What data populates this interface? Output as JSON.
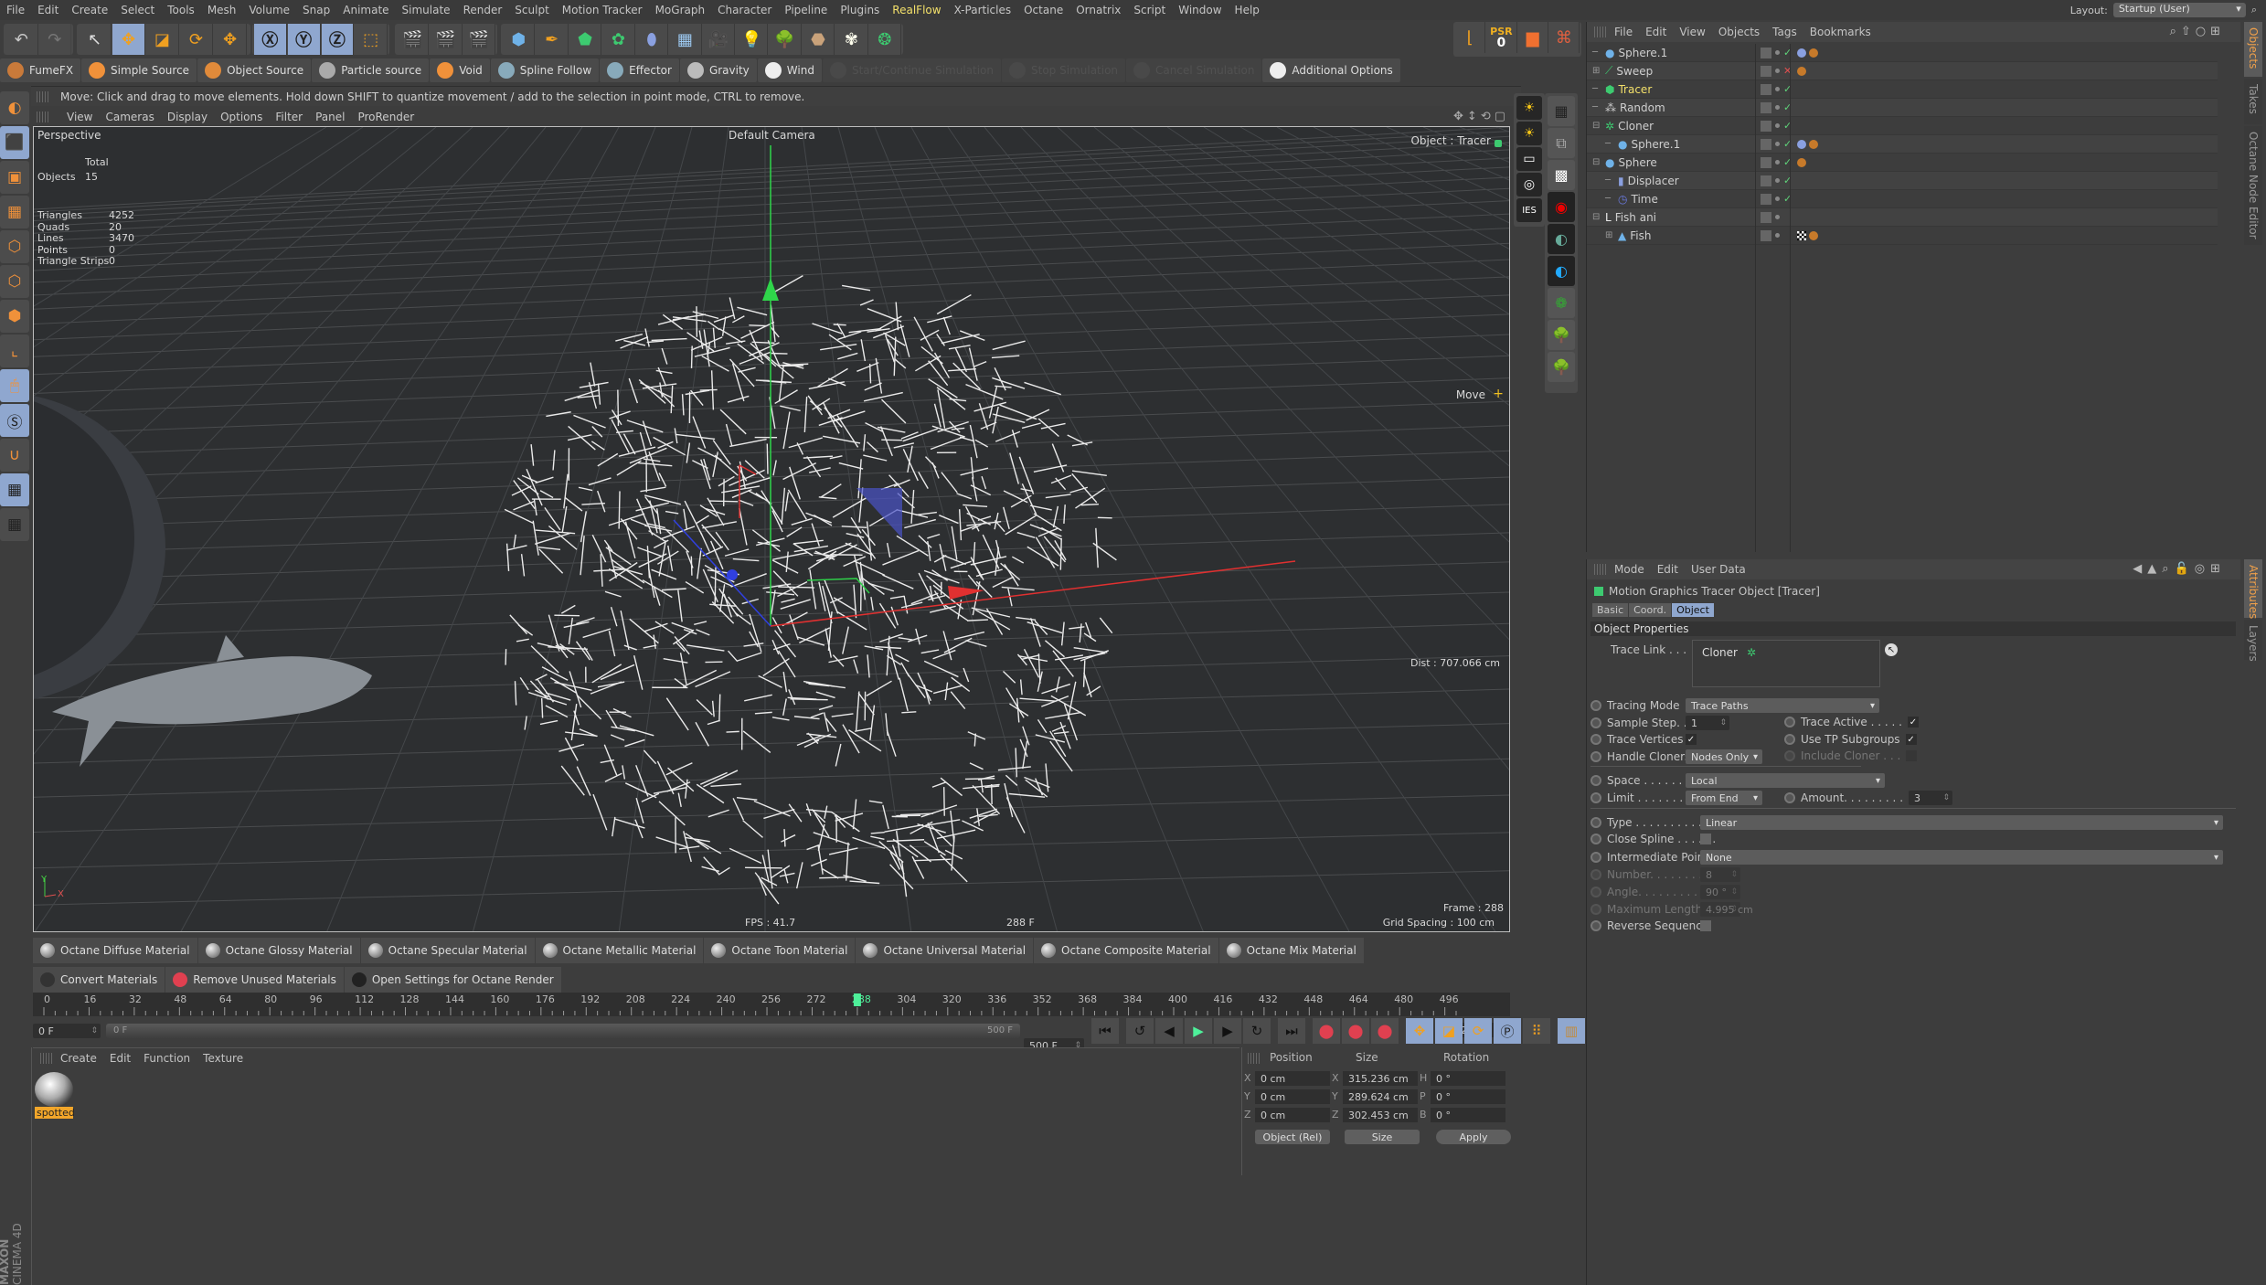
{
  "menubar": {
    "items": [
      "File",
      "Edit",
      "Create",
      "Select",
      "Tools",
      "Mesh",
      "Volume",
      "Snap",
      "Animate",
      "Simulate",
      "Render",
      "Sculpt",
      "Motion Tracker",
      "MoGraph",
      "Character",
      "Pipeline",
      "Plugins",
      "RealFlow",
      "X-Particles",
      "Octane",
      "Ornatrix",
      "Script",
      "Window",
      "Help"
    ],
    "highlighted": "RealFlow",
    "layout_label": "Layout:",
    "layout_value": "Startup (User)"
  },
  "main_toolbar": {
    "groups": [
      [
        "undo-icon",
        "redo-icon"
      ],
      [
        "live-selection-icon",
        "move-icon",
        "scale-icon",
        "rotate-icon"
      ],
      [
        "recent-tools-icon"
      ],
      [
        "x-axis-lock-icon",
        "y-axis-lock-icon",
        "z-axis-lock-icon",
        "coordinate-system-icon"
      ],
      [
        "render-view-icon",
        "render-to-picture-viewer-icon",
        "render-settings-icon"
      ],
      [
        "cube-icon",
        "pen-icon",
        "subdivision-icon",
        "array-icon",
        "deformer-icon",
        "floor-icon",
        "camera-icon",
        "light-icon",
        "tree-icon",
        "rock-icon",
        "flower-icon",
        "gear-plant-icon"
      ]
    ],
    "right_group": {
      "psr_label": "PSR",
      "psr_value": "0"
    }
  },
  "realflow_bar": {
    "buttons": [
      {
        "label": "FumeFX",
        "icon": "fumefx-icon",
        "enabled": true
      },
      {
        "label": "Simple Source",
        "icon": "simple-source-icon",
        "enabled": true
      },
      {
        "label": "Object Source",
        "icon": "object-source-icon",
        "enabled": true
      },
      {
        "label": "Particle source",
        "icon": "particle-source-icon",
        "enabled": true
      },
      {
        "label": "Void",
        "icon": "void-icon",
        "enabled": true
      },
      {
        "label": "Spline Follow",
        "icon": "spline-follow-icon",
        "enabled": true
      },
      {
        "label": "Effector",
        "icon": "effector-icon",
        "enabled": true
      },
      {
        "label": "Gravity",
        "icon": "gravity-icon",
        "enabled": true
      },
      {
        "label": "Wind",
        "icon": "wind-icon",
        "enabled": true
      },
      {
        "label": "Start/Continue Simulation",
        "icon": "play-icon",
        "enabled": false
      },
      {
        "label": "Stop Simulation",
        "icon": "stop-icon",
        "enabled": false
      },
      {
        "label": "Cancel Simulation",
        "icon": "cancel-icon",
        "enabled": false
      },
      {
        "label": "Additional Options",
        "icon": "gear-icon",
        "enabled": true
      }
    ]
  },
  "status": {
    "text": "Move: Click and drag to move elements. Hold down SHIFT to quantize movement / add to the selection in point mode, CTRL to remove."
  },
  "viewport": {
    "menu": [
      "View",
      "Cameras",
      "Display",
      "Options",
      "Filter",
      "Panel",
      "ProRender"
    ],
    "name": "Perspective",
    "camera": "Default Camera",
    "object_label": "Object : Tracer",
    "tool_label": "Move",
    "stats": {
      "header": "Total",
      "rows": [
        {
          "label": "Objects",
          "value": "15"
        },
        {
          "label": "Triangles",
          "value": "4252"
        },
        {
          "label": "Quads",
          "value": "20"
        },
        {
          "label": "Lines",
          "value": "3470"
        },
        {
          "label": "Points",
          "value": "0"
        },
        {
          "label": "Triangle Strips",
          "value": "0"
        }
      ]
    },
    "dist": "Dist : 707.066 cm",
    "frame": "Frame : 288",
    "fps": "FPS : 41.7",
    "frame_center": "288 F",
    "grid_spacing": "Grid Spacing : 100 cm",
    "axis_x": "X",
    "axis_y": "Y"
  },
  "objects_panel": {
    "menu": [
      "File",
      "Edit",
      "View",
      "Objects",
      "Tags",
      "Bookmarks"
    ],
    "rows": [
      {
        "name": "Sphere.1",
        "icon": "sphere-icon",
        "indent": 0,
        "expand": "",
        "active": false,
        "check": "ok",
        "tags": [
          "material-tag",
          "phong-tag"
        ]
      },
      {
        "name": "Sweep",
        "icon": "sweep-icon",
        "indent": 0,
        "expand": "+",
        "active": false,
        "check": "x",
        "tags": [
          "phong-tag"
        ]
      },
      {
        "name": "Tracer",
        "icon": "tracer-icon",
        "indent": 0,
        "expand": "",
        "active": true,
        "check": "ok",
        "tags": []
      },
      {
        "name": "Random",
        "icon": "random-effector-icon",
        "indent": 0,
        "expand": "",
        "active": false,
        "check": "ok",
        "tags": []
      },
      {
        "name": "Cloner",
        "icon": "cloner-icon",
        "indent": 0,
        "expand": "-",
        "active": false,
        "check": "ok",
        "tags": []
      },
      {
        "name": "Sphere.1",
        "icon": "sphere-icon",
        "indent": 1,
        "expand": "",
        "active": false,
        "check": "ok",
        "tags": [
          "material-tag",
          "phong-tag"
        ]
      },
      {
        "name": "Sphere",
        "icon": "sphere-icon",
        "indent": 0,
        "expand": "-",
        "active": false,
        "check": "ok",
        "tags": [
          "phong-tag"
        ]
      },
      {
        "name": "Displacer",
        "icon": "displacer-icon",
        "indent": 1,
        "expand": "",
        "active": false,
        "check": "ok",
        "tags": []
      },
      {
        "name": "Time",
        "icon": "time-icon",
        "indent": 1,
        "expand": "",
        "active": false,
        "check": "ok",
        "tags": []
      },
      {
        "name": "Fish ani",
        "icon": "null-icon",
        "indent": 0,
        "expand": "-",
        "active": false,
        "check": "",
        "tags": []
      },
      {
        "name": "Fish",
        "icon": "polygon-icon",
        "indent": 1,
        "expand": "+",
        "active": false,
        "check": "",
        "tags": [
          "texture-tag",
          "phong-tag"
        ]
      }
    ],
    "side_tabs": [
      "Objects",
      "Takes",
      "Octane Node Editor"
    ]
  },
  "attributes_panel": {
    "menu": [
      "Mode",
      "Edit",
      "User Data"
    ],
    "title": "Motion Graphics Tracer Object [Tracer]",
    "tabs": [
      "Basic",
      "Coord.",
      "Object"
    ],
    "active_tab": "Object",
    "section": "Object Properties",
    "trace_link_label": "Trace Link . . .",
    "trace_link_value": "Cloner",
    "tracing_mode_label": "Tracing Mode",
    "tracing_mode": "Trace Paths",
    "sample_step_label": "Sample Step. .",
    "sample_step": "1",
    "trace_active_label": "Trace Active . . . . .",
    "trace_active": true,
    "trace_vertices_label": "Trace Vertices",
    "trace_vertices": true,
    "use_tp_label": "Use TP Subgroups",
    "use_tp": true,
    "handle_cloners_label": "Handle Cloners",
    "handle_cloners": "Nodes Only",
    "include_cloner_label": "Include Cloner . . .",
    "include_cloner": false,
    "space_label": "Space . . . . . . . .",
    "space": "Local",
    "limit_label": "Limit . . . . . . . . .",
    "limit": "From End",
    "amount_label": "Amount. . . . . . . . .",
    "amount": "3",
    "type_label": "Type . . . . . . . . . . . .",
    "type": "Linear",
    "close_spline_label": "Close Spline . . . . . .",
    "close_spline": false,
    "intermediate_label": "Intermediate Points",
    "intermediate": "None",
    "number_label": "Number. . . . . . . . . .",
    "number": "8",
    "angle_label": "Angle. . . . . . . . . . . .",
    "angle": "90 °",
    "max_length_label": "Maximum Length. .",
    "max_length": "4.995 cm",
    "reverse_label": "Reverse Sequence",
    "reverse": false,
    "side_tabs": [
      "Attributes",
      "Layers"
    ]
  },
  "material_bar": {
    "row1": [
      "Octane Diffuse Material",
      "Octane Glossy Material",
      "Octane Specular Material",
      "Octane Metallic Material",
      "Octane Toon Material",
      "Octane Universal Material",
      "Octane Composite Material",
      "Octane Mix Material"
    ],
    "row2": [
      "Convert Materials",
      "Remove Unused Materials",
      "Open Settings for Octane Render"
    ]
  },
  "timeline": {
    "ticks": [
      "0",
      "16",
      "32",
      "48",
      "64",
      "80",
      "96",
      "112",
      "128",
      "144",
      "160",
      "176",
      "192",
      "208",
      "224",
      "240",
      "256",
      "272",
      "288",
      "304",
      "320",
      "336",
      "352",
      "368",
      "384",
      "400",
      "416",
      "432",
      "448",
      "464",
      "480",
      "496"
    ],
    "current_frame": 288,
    "max_frame": 500,
    "current_field": "288 F",
    "start_field": "0 F",
    "range_start": "0 F",
    "range_end": "500 F",
    "end_field": "500 F"
  },
  "material_manager": {
    "menu": [
      "Create",
      "Edit",
      "Function",
      "Texture"
    ],
    "materials": [
      {
        "name": "spotted"
      }
    ]
  },
  "coordinates": {
    "headers": [
      "Position",
      "Size",
      "Rotation"
    ],
    "position": [
      {
        "axis": "X",
        "value": "0 cm"
      },
      {
        "axis": "Y",
        "value": "0 cm"
      },
      {
        "axis": "Z",
        "value": "0 cm"
      }
    ],
    "size": [
      {
        "axis": "X",
        "value": "315.236 cm"
      },
      {
        "axis": "Y",
        "value": "289.624 cm"
      },
      {
        "axis": "Z",
        "value": "302.453 cm"
      }
    ],
    "rotation": [
      {
        "axis": "H",
        "value": "0 °"
      },
      {
        "axis": "P",
        "value": "0 °"
      },
      {
        "axis": "B",
        "value": "0 °"
      }
    ],
    "mode": "Object (Rel)",
    "size_mode": "Size",
    "apply": "Apply"
  },
  "branding": {
    "maxon": "MAXON",
    "product": "CINEMA 4D"
  },
  "colors": {
    "accent_active": "#f3e06a",
    "selected_tab": "#8fa7cf",
    "orange": "#f0913a",
    "check_green": "#5fd47a",
    "x_red": "#e05050",
    "material_label": "#f2a62a"
  }
}
